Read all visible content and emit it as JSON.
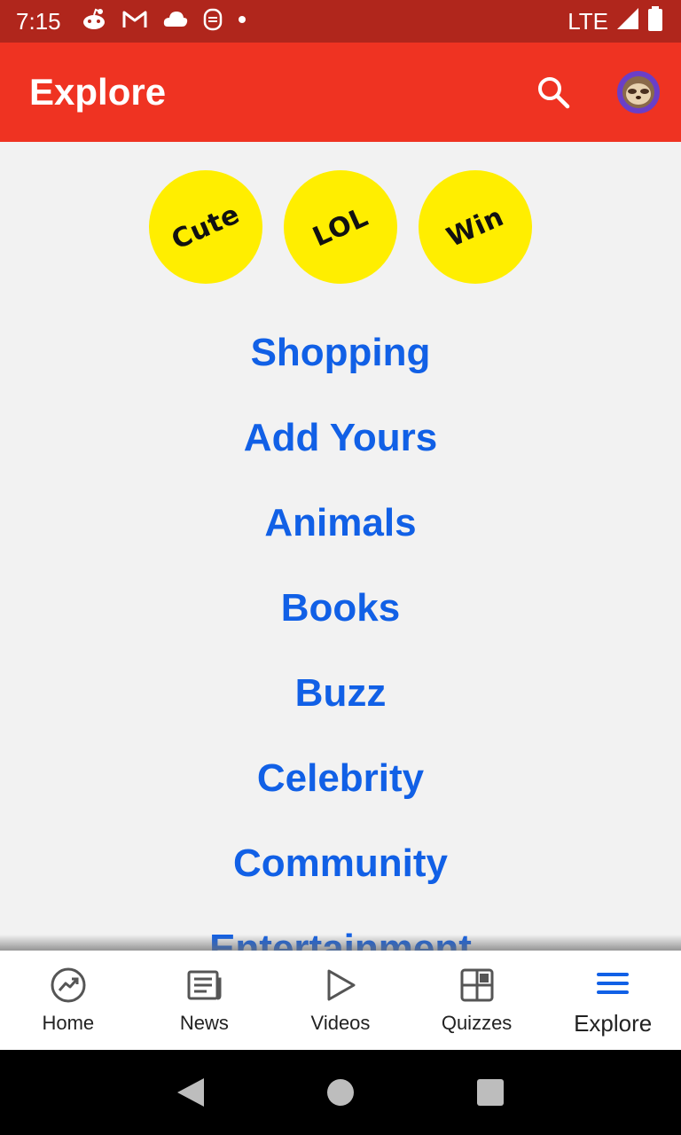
{
  "status_bar": {
    "time": "7:15",
    "network": "LTE",
    "icons": [
      "reddit-icon",
      "gmail-icon",
      "cloud-icon",
      "app-icon",
      "dot-icon"
    ]
  },
  "app_bar": {
    "title": "Explore",
    "search_icon": "search-icon",
    "avatar_icon": "sloth-avatar"
  },
  "badges": [
    {
      "label": "Cute"
    },
    {
      "label": "LOL"
    },
    {
      "label": "Win"
    }
  ],
  "categories": [
    "Shopping",
    "Add Yours",
    "Animals",
    "Books",
    "Buzz",
    "Celebrity",
    "Community",
    "Entertainment"
  ],
  "bottom_nav": [
    {
      "label": "Home",
      "icon": "trending-icon",
      "active": false
    },
    {
      "label": "News",
      "icon": "newspaper-icon",
      "active": false
    },
    {
      "label": "Videos",
      "icon": "play-icon",
      "active": false
    },
    {
      "label": "Quizzes",
      "icon": "grid-icon",
      "active": false
    },
    {
      "label": "Explore",
      "icon": "menu-icon",
      "active": true
    }
  ],
  "colors": {
    "status_bar": "#b0261c",
    "app_bar": "#ef3322",
    "badge": "#ffee00",
    "link": "#1160e6",
    "active_nav": "#1160e6"
  }
}
